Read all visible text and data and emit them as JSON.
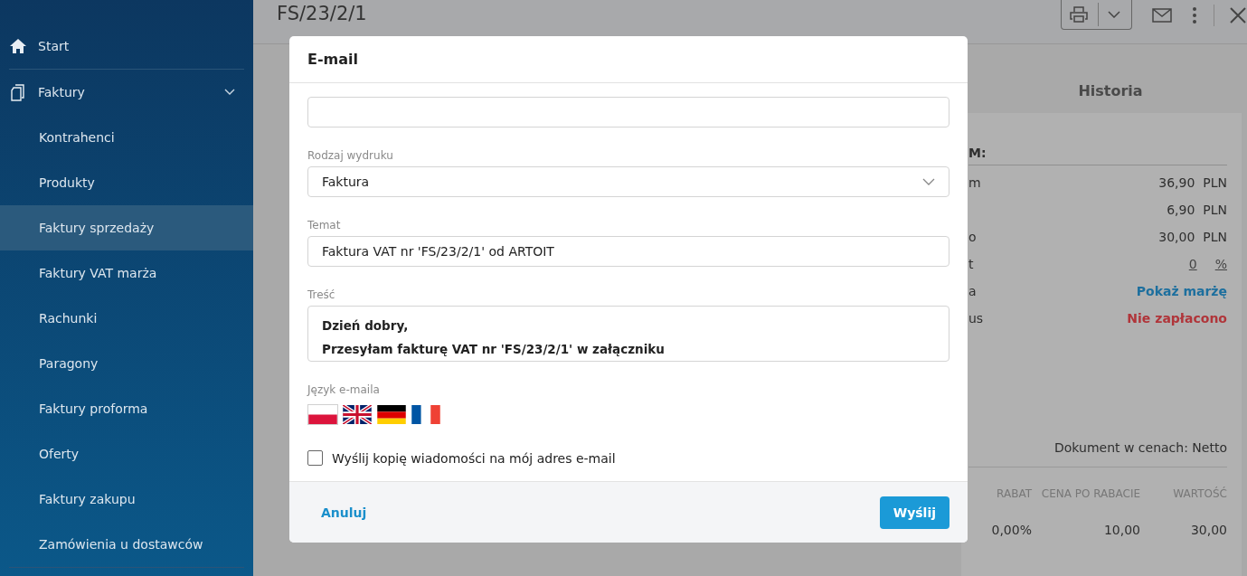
{
  "sidebar": {
    "items": [
      {
        "label": "Start",
        "kind": "icon-home",
        "selected": false
      },
      {
        "label": "Faktury",
        "kind": "icon-docs",
        "selected": false,
        "expanded": true,
        "children": [
          {
            "label": "Kontrahenci",
            "selected": false
          },
          {
            "label": "Produkty",
            "selected": false
          },
          {
            "label": "Faktury sprzedaży",
            "selected": true
          },
          {
            "label": "Faktury VAT marża",
            "selected": false
          },
          {
            "label": "Rachunki",
            "selected": false
          },
          {
            "label": "Paragony",
            "selected": false
          },
          {
            "label": "Faktury proforma",
            "selected": false
          },
          {
            "label": "Oferty",
            "selected": false
          },
          {
            "label": "Faktury zakupu",
            "selected": false
          },
          {
            "label": "Zamówienia u dostawców",
            "selected": false
          }
        ]
      }
    ]
  },
  "document": {
    "title": "FS/23/2/1",
    "tab": "Historia",
    "summary_heading": "M:",
    "summary_rows": [
      {
        "label": "m",
        "value": "36,90",
        "unit": "PLN",
        "kind": "amount"
      },
      {
        "label": "",
        "value": "6,90",
        "unit": "PLN",
        "kind": "amount"
      },
      {
        "label": "o",
        "value": "30,00",
        "unit": "PLN",
        "kind": "amount"
      },
      {
        "label": "t",
        "value": "0",
        "unit": "%",
        "kind": "discount"
      },
      {
        "label": "a",
        "value": "Pokaż marżę",
        "kind": "link"
      },
      {
        "label": "us",
        "value": "Nie zapłacono",
        "kind": "status"
      }
    ],
    "price_mode": "Dokument w cenach: Netto",
    "table": {
      "columns": [
        "RABAT",
        "CENA PO RABACIE",
        "WARTOŚĆ"
      ],
      "rows": [
        [
          "0,00%",
          "10,00",
          "30,00"
        ]
      ]
    }
  },
  "dialog": {
    "title": "E-mail",
    "print_type": {
      "label": "Rodzaj wydruku",
      "value": "Faktura"
    },
    "subject": {
      "label": "Temat",
      "value": "Faktura VAT nr 'FS/23/2/1' od ARTOIT"
    },
    "body": {
      "label": "Treść",
      "lines": [
        "Dzień dobry,",
        "Przesyłam fakturę VAT nr 'FS/23/2/1' w załączniku"
      ]
    },
    "language": {
      "label": "Język e-maila",
      "options": [
        {
          "kind": "pl",
          "selected": true
        },
        {
          "kind": "gb",
          "selected": false
        },
        {
          "kind": "de",
          "selected": false
        },
        {
          "kind": "fr",
          "selected": false
        }
      ]
    },
    "copy_checkbox": {
      "label": "Wyślij kopię wiadomości na mój adres e-mail",
      "checked": false
    },
    "cancel": "Anuluj",
    "send": "Wyślij"
  }
}
